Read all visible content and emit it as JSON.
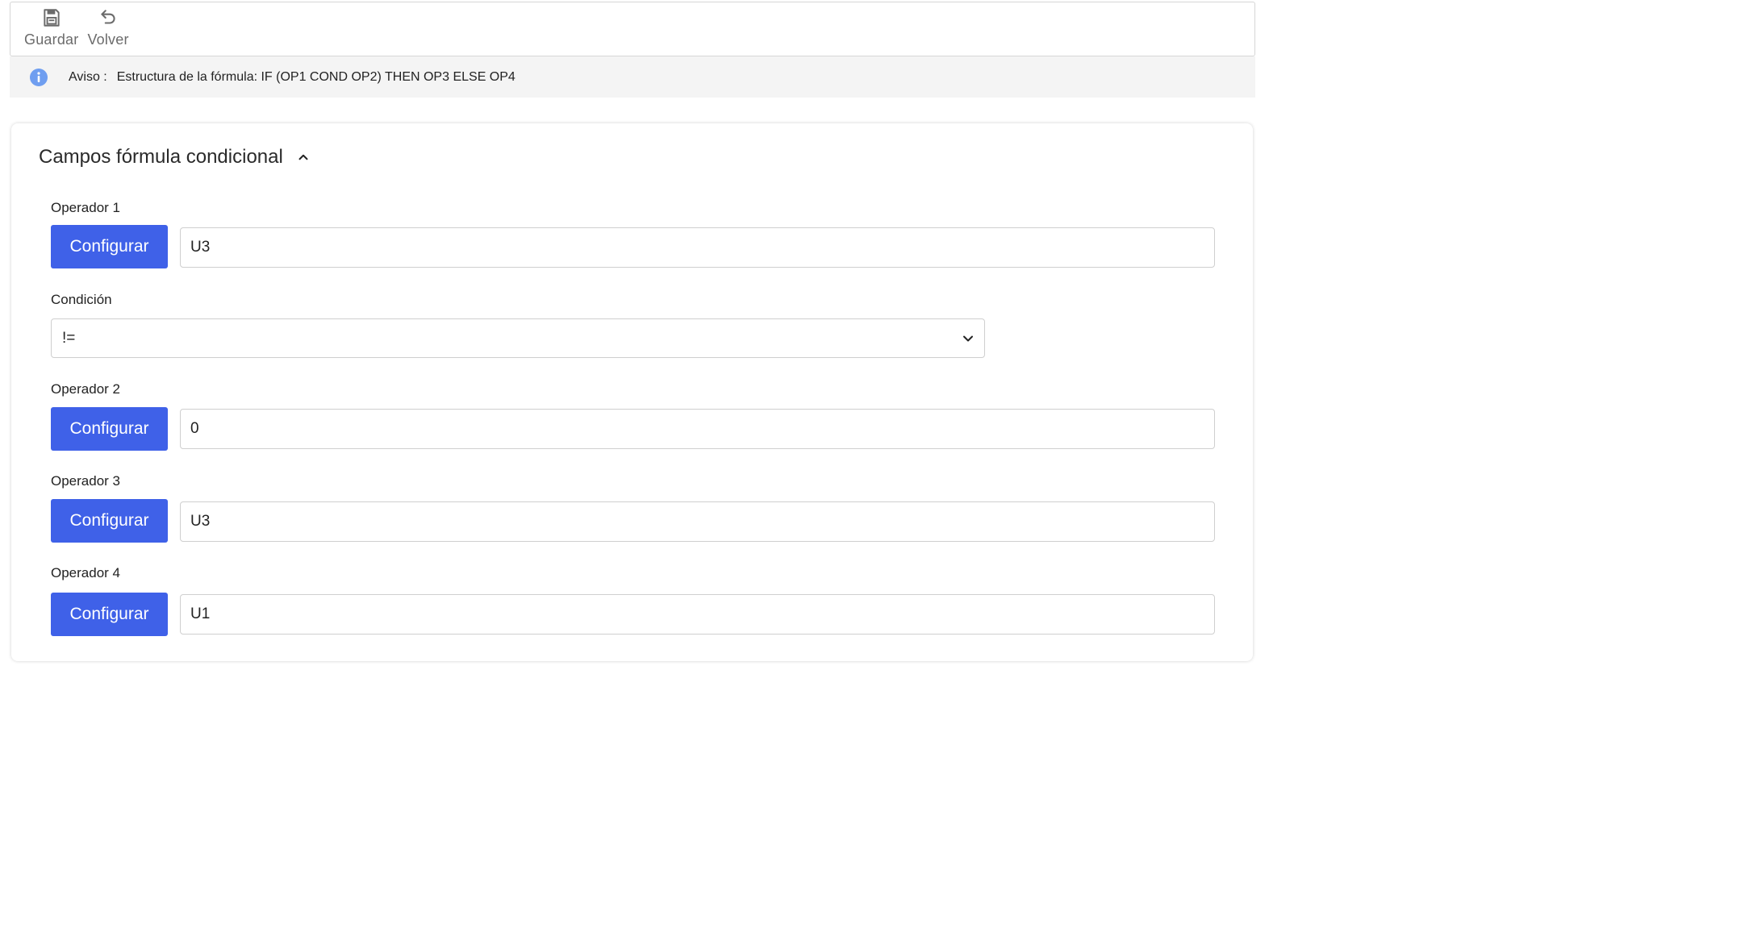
{
  "toolbar": {
    "save_label": "Guardar",
    "back_label": "Volver"
  },
  "notice": {
    "title": "Aviso :",
    "text": "Estructura de la fórmula: IF (OP1 COND OP2) THEN OP3 ELSE OP4"
  },
  "section": {
    "title": "Campos fórmula condicional"
  },
  "fields": {
    "op1": {
      "label": "Operador 1",
      "button": "Configurar",
      "value": "U3"
    },
    "condition": {
      "label": "Condición",
      "value": "!="
    },
    "op2": {
      "label": "Operador 2",
      "button": "Configurar",
      "value": "0"
    },
    "op3": {
      "label": "Operador 3",
      "button": "Configurar",
      "value": "U3"
    },
    "op4": {
      "label": "Operador 4",
      "button": "Configurar",
      "value": "U1"
    }
  },
  "colors": {
    "primary": "#3f61e8",
    "info": "#6f9ef0",
    "notice_bg": "#f4f4f4"
  }
}
